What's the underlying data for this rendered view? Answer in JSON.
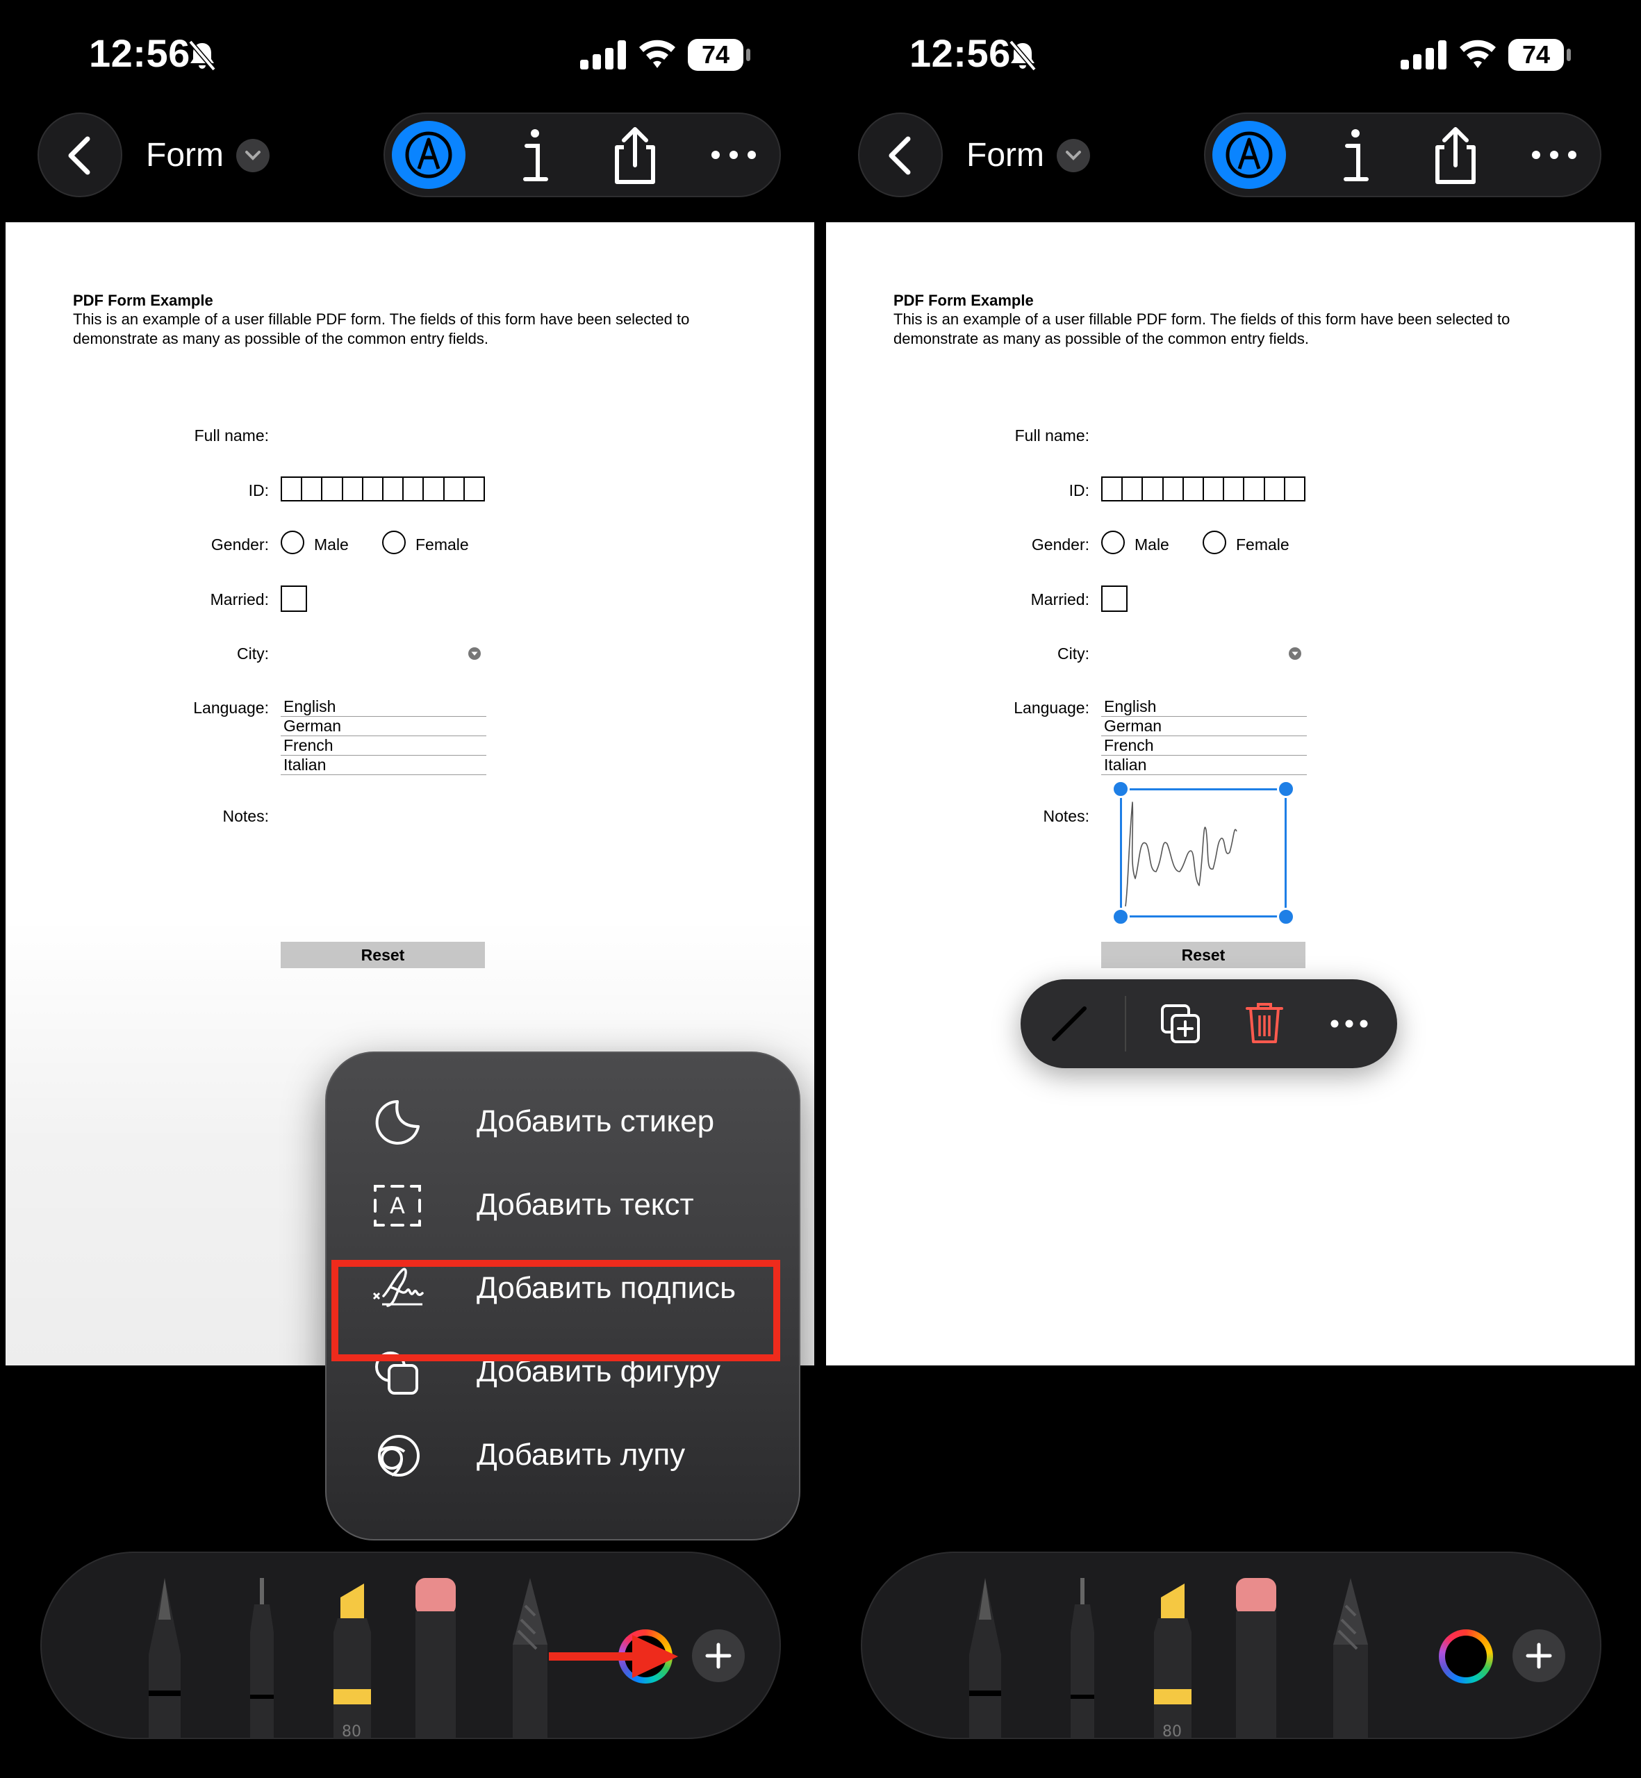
{
  "status_bar": {
    "time": "12:56",
    "battery": "74"
  },
  "nav": {
    "title": "Form"
  },
  "document": {
    "heading": "PDF Form Example",
    "intro": "This is an example of a user fillable PDF form. The fields of this form have been selected to demonstrate as many as possible of the common entry fields.",
    "labels": {
      "full_name": "Full name:",
      "id": "ID:",
      "gender": "Gender:",
      "married": "Married:",
      "city": "City:",
      "language": "Language:",
      "notes": "Notes:"
    },
    "gender_options": [
      "Male",
      "Female"
    ],
    "languages": [
      "English",
      "German",
      "French",
      "Italian"
    ],
    "reset": "Reset"
  },
  "add_menu": {
    "items": [
      {
        "label": "Добавить стикер",
        "icon": "sticker-icon"
      },
      {
        "label": "Добавить текст",
        "icon": "text-box-icon"
      },
      {
        "label": "Добавить подпись",
        "icon": "signature-icon",
        "highlighted": true
      },
      {
        "label": "Добавить фигуру",
        "icon": "shapes-icon"
      },
      {
        "label": "Добавить лупу",
        "icon": "magnifier-icon"
      }
    ]
  },
  "palette": {
    "tools": [
      "pen",
      "fineliner",
      "highlighter",
      "eraser",
      "pencil"
    ],
    "highlighter_width": "80"
  },
  "colors": {
    "accent": "#0a84ff",
    "highlight_frame": "#ee2b1c",
    "selection": "#1e7fe6",
    "delete": "#ff5a4e"
  }
}
